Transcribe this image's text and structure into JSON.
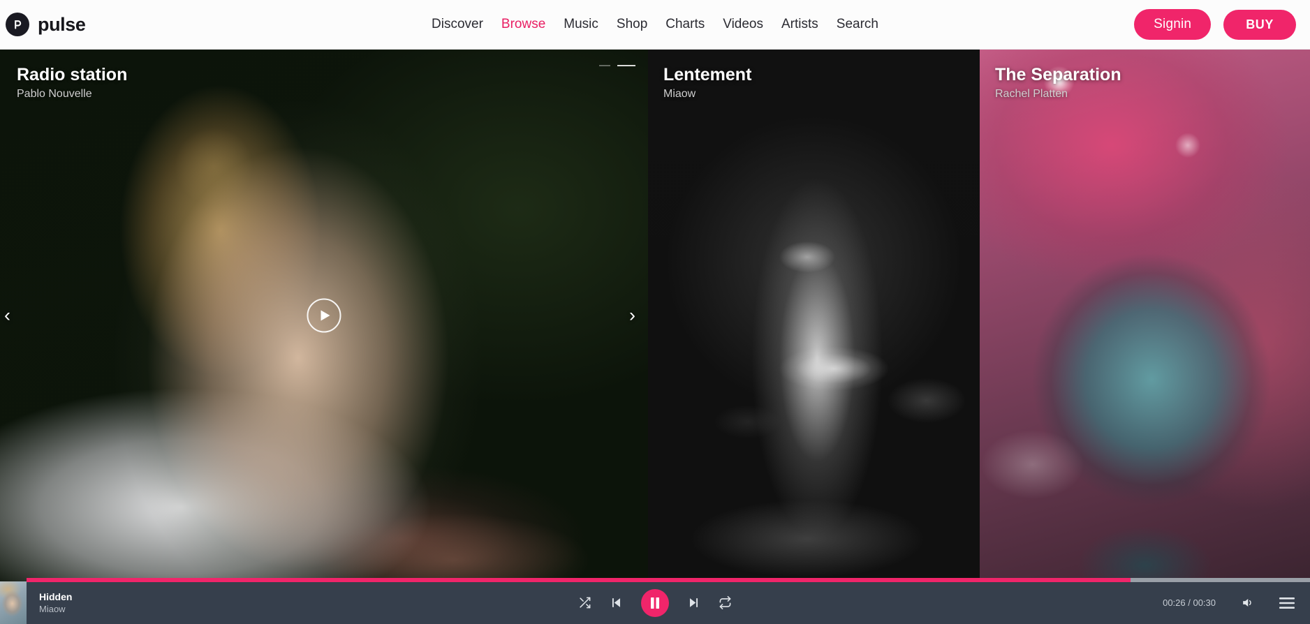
{
  "header": {
    "brand": {
      "name": "pulse",
      "logo_icon": "pulse-logo-icon"
    },
    "nav": [
      {
        "label": "Discover",
        "active": false
      },
      {
        "label": "Browse",
        "active": true
      },
      {
        "label": "Music",
        "active": false
      },
      {
        "label": "Shop",
        "active": false
      },
      {
        "label": "Charts",
        "active": false
      },
      {
        "label": "Videos",
        "active": false
      },
      {
        "label": "Artists",
        "active": false
      },
      {
        "label": "Search",
        "active": false
      }
    ],
    "signin_label": "Signin",
    "buy_label": "BUY"
  },
  "hero": {
    "cards": [
      {
        "title": "Radio station",
        "artist": "Pablo Nouvelle"
      },
      {
        "title": "Lentement",
        "artist": "Miaow"
      },
      {
        "title": "The Separation",
        "artist": "Rachel Platten"
      }
    ],
    "prev_icon": "chevron-left-icon",
    "next_icon": "chevron-right-icon",
    "play_icon": "play-icon",
    "dots": 2,
    "active_dot": 2
  },
  "player": {
    "track": "Hidden",
    "artist": "Miaow",
    "current_time": "00:26",
    "total_time": "00:30",
    "time_display": "00:26 / 00:30",
    "progress_percent": 86,
    "shuffle_icon": "shuffle-icon",
    "prev_icon": "skip-previous-icon",
    "play_icon": "pause-icon",
    "next_icon": "skip-next-icon",
    "repeat_icon": "repeat-icon",
    "volume_icon": "volume-icon",
    "playlist_icon": "playlist-menu-icon"
  },
  "colors": {
    "accent": "#f0256a",
    "nav_active": "#e91e63",
    "player_bg": "#363f4c",
    "header_bg": "#fcfcfc"
  }
}
